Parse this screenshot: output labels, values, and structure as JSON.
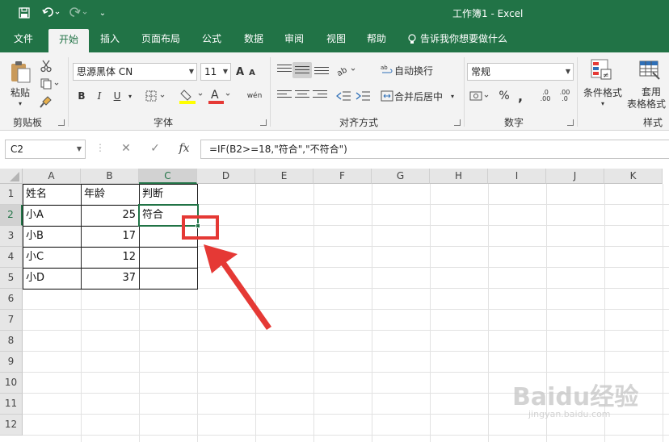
{
  "title_bar": {
    "title": "工作簿1  -  Excel",
    "qat": [
      "save-icon",
      "undo-icon",
      "redo-icon",
      "customize-icon"
    ]
  },
  "tabs": [
    {
      "label": "文件"
    },
    {
      "label": "开始",
      "active": true
    },
    {
      "label": "插入"
    },
    {
      "label": "页面布局"
    },
    {
      "label": "公式"
    },
    {
      "label": "数据"
    },
    {
      "label": "审阅"
    },
    {
      "label": "视图"
    },
    {
      "label": "帮助"
    },
    {
      "label": "告诉我你想要做什么"
    }
  ],
  "ribbon": {
    "clipboard": {
      "paste": "粘贴",
      "label": "剪贴板"
    },
    "font": {
      "name": "思源黑体 CN",
      "size": "11",
      "label": "字体",
      "bold": "B",
      "italic": "I",
      "underline": "U",
      "phonetic": "wén",
      "grow": "A",
      "shrink": "A"
    },
    "alignment": {
      "wrap": "自动换行",
      "merge": "合并后居中",
      "label": "对齐方式"
    },
    "number": {
      "format": "常规",
      "percent": "%",
      "comma": ",",
      "inc_decimal": ".00",
      "dec_decimal": ".0",
      "label": "数字"
    },
    "styles": {
      "conditional": "条件格式",
      "table_1": "套用",
      "table_2": "表格格式",
      "label": "样式"
    }
  },
  "formula_bar": {
    "name_box": "C2",
    "cancel": "✕",
    "enter": "✓",
    "fx": "fx",
    "formula": "=IF(B2>=18,\"符合\",\"不符合\")"
  },
  "grid": {
    "columns": [
      "A",
      "B",
      "C",
      "D",
      "E",
      "F",
      "G",
      "H",
      "I",
      "J",
      "K"
    ],
    "rows": [
      "1",
      "2",
      "3",
      "4",
      "5",
      "6",
      "7",
      "8",
      "9",
      "10",
      "11",
      "12"
    ],
    "selected_column": "C",
    "selected_row": "2",
    "cells": {
      "A1": "姓名",
      "B1": "年龄",
      "C1": "判断",
      "A2": "小A",
      "B2": "25",
      "C2": "符合",
      "A3": "小B",
      "B3": "17",
      "A4": "小C",
      "B4": "12",
      "A5": "小D",
      "B5": "37"
    }
  },
  "watermark": {
    "line1": "Baidu经验",
    "line2": "jingyan.baidu.com"
  },
  "colors": {
    "excel_green": "#217346",
    "annotation_red": "#e53935"
  }
}
